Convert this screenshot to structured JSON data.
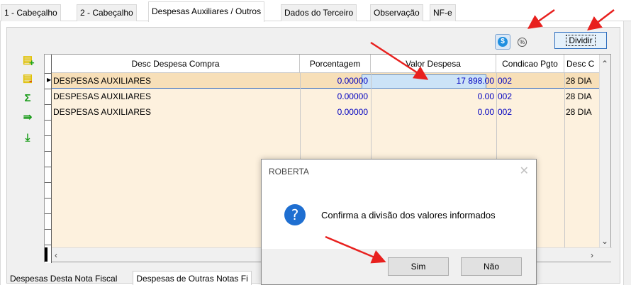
{
  "tabs": [
    {
      "label": "1 - Cabeçalho"
    },
    {
      "label": "2 - Cabeçalho"
    },
    {
      "label": "Despesas Auxiliares / Outros",
      "active": true
    },
    {
      "label": "Dados do Terceiro"
    },
    {
      "label": "Observação"
    },
    {
      "label": "NF-e"
    }
  ],
  "toolbar": {
    "currency_icon": "currency-coin-icon",
    "percent_icon": "percent-icon",
    "dividir_label": "Dividir"
  },
  "side_icons": [
    "add-row-icon",
    "remove-row-icon",
    "sum-icon",
    "export-icon",
    "download-icon"
  ],
  "grid": {
    "columns": [
      "Desc Despesa Compra",
      "Porcentagem",
      "Valor Despesa",
      "Condicao Pgto",
      "Desc C"
    ],
    "rows": [
      {
        "desc": "DESPESAS AUXILIARES",
        "pct": "0.00000",
        "valor": "17 898.00",
        "cond": "002",
        "descc": "28 DIA"
      },
      {
        "desc": "DESPESAS AUXILIARES",
        "pct": "0.00000",
        "valor": "0.00",
        "cond": "002",
        "descc": "28 DIA"
      },
      {
        "desc": "DESPESAS AUXILIARES",
        "pct": "0.00000",
        "valor": "0.00",
        "cond": "002",
        "descc": "28 DIA"
      }
    ]
  },
  "bottom_tabs": [
    "Despesas Desta Nota Fiscal",
    "Despesas de Outras Notas Fi"
  ],
  "dialog": {
    "title": "ROBERTA",
    "message": "Confirma a divisão dos valores informados",
    "yes_label": "Sim",
    "no_label": "Não"
  },
  "colors": {
    "annotation_arrow": "#e8201e",
    "selected_row": "#f7dfb8",
    "grid_body": "#fdf1de",
    "number_text": "#0000c0"
  }
}
